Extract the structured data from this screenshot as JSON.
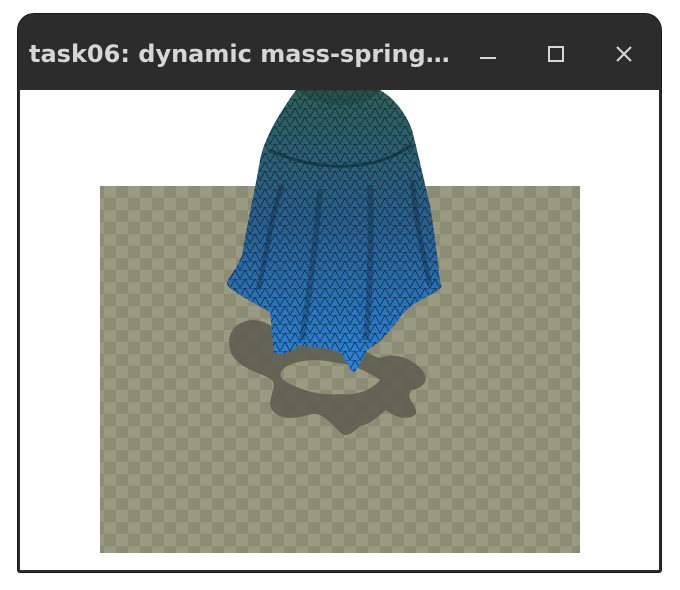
{
  "window": {
    "title": "task06: dynamic mass-spring…",
    "controls": {
      "minimize_icon": "minimize-icon",
      "maximize_icon": "maximize-icon",
      "close_icon": "close-icon"
    }
  },
  "scene": {
    "background_color": "#ffffff",
    "floor_color_light": "#9a9a80",
    "floor_color_dark": "#8c8c75",
    "shadow_color": "#5e5e52",
    "cloth_color_top": "#2e5f58",
    "cloth_color_bottom": "#2a7fd8",
    "cloth_line_color": "#0b1820"
  }
}
